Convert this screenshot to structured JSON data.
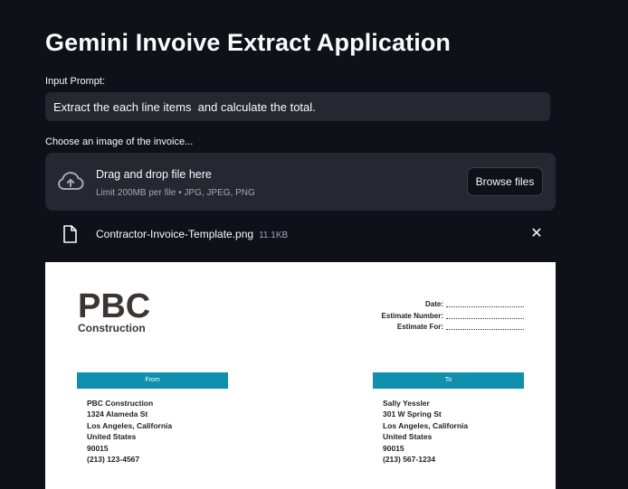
{
  "app": {
    "title": "Gemini Invoive Extract Application"
  },
  "prompt": {
    "label": "Input Prompt:",
    "value": "Extract the each line items  and calculate the total."
  },
  "uploader": {
    "label": "Choose an image of the invoice...",
    "drag_text": "Drag and drop file here",
    "limit_text": "Limit 200MB per file • JPG, JPEG, PNG",
    "browse_label": "Browse files",
    "upload_icon": "cloud-upload-icon"
  },
  "file": {
    "name": "Contractor-Invoice-Template.png",
    "size": "11.1KB",
    "icon": "file-icon",
    "close_icon": "close-icon",
    "close_glyph": "✕"
  },
  "invoice": {
    "brand": "PBC",
    "brand_sub": "Construction",
    "fields": [
      "Date:",
      "Estimate Number:",
      "Estimate For:"
    ],
    "from": {
      "header": "From",
      "lines": [
        "PBC Construction",
        "1324 Alameda St",
        "Los Angeles, California",
        "United States",
        "90015",
        "(213) 123-4567"
      ]
    },
    "to": {
      "header": "To",
      "lines": [
        "Sally Yessler",
        "301 W Spring St",
        "Los Angeles, California",
        "United States",
        "90015",
        "(213) 567-1234"
      ]
    },
    "accent_color": "#1190ae"
  },
  "colors": {
    "background": "#0e1117",
    "widget": "#262730",
    "text": "#fafafa",
    "muted": "#a3a8b8"
  }
}
